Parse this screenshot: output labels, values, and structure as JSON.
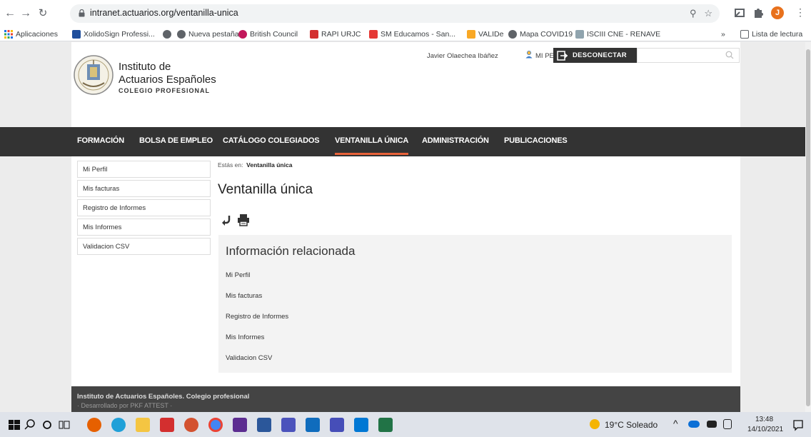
{
  "browser": {
    "url": "intranet.actuarios.org/ventanilla-unica",
    "profile_initial": "J",
    "bookmarks": [
      "Aplicaciones",
      "XolidoSign Professi...",
      "",
      "Nueva pestaña",
      "British Council",
      "RAPI URJC",
      "SM Educamos - San...",
      "VALIDe",
      "Mapa COVID19",
      "ISCIII CNE - RENAVE"
    ],
    "bookmarks_overflow": "»",
    "reading_list": "Lista de lectura"
  },
  "header": {
    "org_line1": "Instituto de",
    "org_line2": "Actuarios Españoles",
    "org_line3": "COLEGIO PROFESIONAL",
    "user_name": "Javier Olaechea Ibáñez",
    "my_profile": "MI PERFIL",
    "logout": "DESCONECTAR",
    "search_placeholder": ""
  },
  "nav": [
    "FORMACIÓN",
    "BOLSA DE EMPLEO",
    "CATÁLOGO COLEGIADOS",
    "VENTANILLA ÚNICA",
    "ADMINISTRACIÓN",
    "PUBLICACIONES"
  ],
  "sidebar": [
    "Mi Perfil",
    "Mis facturas",
    "Registro de Informes",
    "Mis Informes",
    "Validacion CSV"
  ],
  "breadcrumb": {
    "prefix": "Estás en:",
    "current": "Ventanilla única"
  },
  "page_title": "Ventanilla única",
  "related": {
    "title": "Información relacionada",
    "links": [
      "Mi Perfil",
      "Mis facturas",
      "Registro de Informes",
      "Mis Informes",
      "Validacion CSV"
    ]
  },
  "footer": {
    "line1": "Instituto de Actuarios Españoles. Colegio profesional",
    "line2": "· Desarrollado por  PKF ATTEST  ·"
  },
  "taskbar": {
    "weather": "19°C  Soleado",
    "time": "13:48",
    "date": "14/10/2021"
  }
}
